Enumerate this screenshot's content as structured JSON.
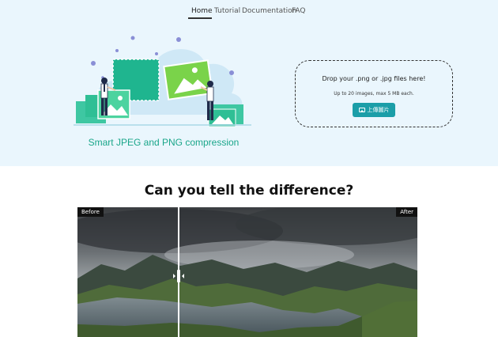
{
  "nav": {
    "items": [
      {
        "label": "Home",
        "active": true
      },
      {
        "label": "Tutorial",
        "active": false
      },
      {
        "label": "Documentation",
        "active": false
      },
      {
        "label": "FAQ",
        "active": false
      }
    ]
  },
  "hero": {
    "caption": "Smart JPEG and PNG compression",
    "background": "#eaf6fd",
    "accent": "#1aa68a"
  },
  "upload": {
    "title": "Drop your .png or .jpg files here!",
    "subtitle": "Up to 20 images, max 5 MB each.",
    "button_label": "上傳圖片",
    "button_icon": "image-icon",
    "button_color": "#1b9ea8"
  },
  "comparison": {
    "title": "Can you tell the difference?",
    "before_label": "Before",
    "after_label": "After",
    "slider_position": 0.3
  }
}
